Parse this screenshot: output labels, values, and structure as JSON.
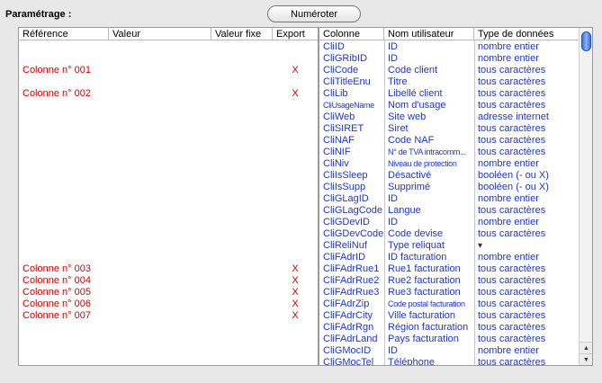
{
  "param_label": "Paramétrage :",
  "numeroter_label": "Numéroter",
  "left_table": {
    "headers": [
      "Référence",
      "Valeur",
      "Valeur fixe",
      "Export"
    ],
    "rows": [
      {
        "ref": "Colonne n° 001",
        "export": "X",
        "line": 2
      },
      {
        "ref": "Colonne n° 002",
        "export": "X",
        "line": 4
      },
      {
        "ref": "Colonne n° 003",
        "export": "X",
        "line": 19
      },
      {
        "ref": "Colonne n° 004",
        "export": "X",
        "line": 20
      },
      {
        "ref": "Colonne n° 005",
        "export": "X",
        "line": 21
      },
      {
        "ref": "Colonne n° 006",
        "export": "X",
        "line": 22
      },
      {
        "ref": "Colonne n° 007",
        "export": "X",
        "line": 23
      }
    ]
  },
  "right_table": {
    "headers": [
      "Colonne",
      "Nom utilisateur",
      "Type de données"
    ],
    "rows": [
      {
        "col": "CliID",
        "nom": "ID",
        "type": "nombre entier"
      },
      {
        "col": "CliGRibID",
        "nom": "ID",
        "type": "nombre entier"
      },
      {
        "col": "CliCode",
        "nom": "Code client",
        "type": "tous caractères"
      },
      {
        "col": "CliTitleEnu",
        "nom": "Titre",
        "type": "tous caractères"
      },
      {
        "col": "CliLib",
        "nom": "Libellé client",
        "type": "tous caractères"
      },
      {
        "col": "CliUsageName",
        "nom": "Nom d'usage",
        "type": "tous caractères",
        "small_col": true
      },
      {
        "col": "CliWeb",
        "nom": "Site web",
        "type": "adresse internet"
      },
      {
        "col": "CliSIRET",
        "nom": "Siret",
        "type": "tous caractères"
      },
      {
        "col": "CliNAF",
        "nom": "Code NAF",
        "type": "tous caractères"
      },
      {
        "col": "CliNIF",
        "nom": "N° de TVA intracomm...",
        "type": "tous caractères",
        "small_nom": true
      },
      {
        "col": "CliNiv",
        "nom": "Niveau de protection",
        "type": "nombre entier",
        "small_nom": true
      },
      {
        "col": "CliIsSleep",
        "nom": "Désactivé",
        "type": "booléen (- ou X)"
      },
      {
        "col": "CliIsSupp",
        "nom": "Supprimé",
        "type": "booléen (- ou X)"
      },
      {
        "col": "CliGLagID",
        "nom": "ID",
        "type": "nombre entier"
      },
      {
        "col": "CliGLagCode",
        "nom": "Langue",
        "type": "tous caractères"
      },
      {
        "col": "CliGDevID",
        "nom": "ID",
        "type": "nombre entier"
      },
      {
        "col": "CliGDevCode",
        "nom": "Code devise",
        "type": "tous caractères"
      },
      {
        "col": "CliReliNuf",
        "nom": "Type reliquat",
        "type": "▾"
      },
      {
        "col": "CliFAdrID",
        "nom": "ID facturation",
        "type": "nombre entier"
      },
      {
        "col": "CliFAdrRue1",
        "nom": "Rue1 facturation",
        "type": "tous caractères"
      },
      {
        "col": "CliFAdrRue2",
        "nom": "Rue2 facturation",
        "type": "tous caractères"
      },
      {
        "col": "CliFAdrRue3",
        "nom": "Rue3 facturation",
        "type": "tous caractères"
      },
      {
        "col": "CliFAdrZip",
        "nom": "Code postal facturation",
        "type": "tous caractères",
        "small_nom": true
      },
      {
        "col": "CliFAdrCity",
        "nom": "Ville facturation",
        "type": "tous caractères"
      },
      {
        "col": "CliFAdrRgn",
        "nom": "Région facturation",
        "type": "tous caractères"
      },
      {
        "col": "CliFAdrLand",
        "nom": "Pays facturation",
        "type": "tous caractères"
      },
      {
        "col": "CliGMocID",
        "nom": "ID",
        "type": "nombre entier"
      },
      {
        "col": "CliGMocTel",
        "nom": "Téléphone",
        "type": "tous caractères"
      }
    ]
  },
  "colors": {
    "ref_red": "#d20000",
    "field_blue": "#1d36c8",
    "scroll_blue": "#3b6fd6"
  },
  "icons": {
    "scroll_up": "scroll-up-arrow-icon",
    "scroll_down": "scroll-down-arrow-icon",
    "dropdown": "dropdown-arrow-icon"
  }
}
